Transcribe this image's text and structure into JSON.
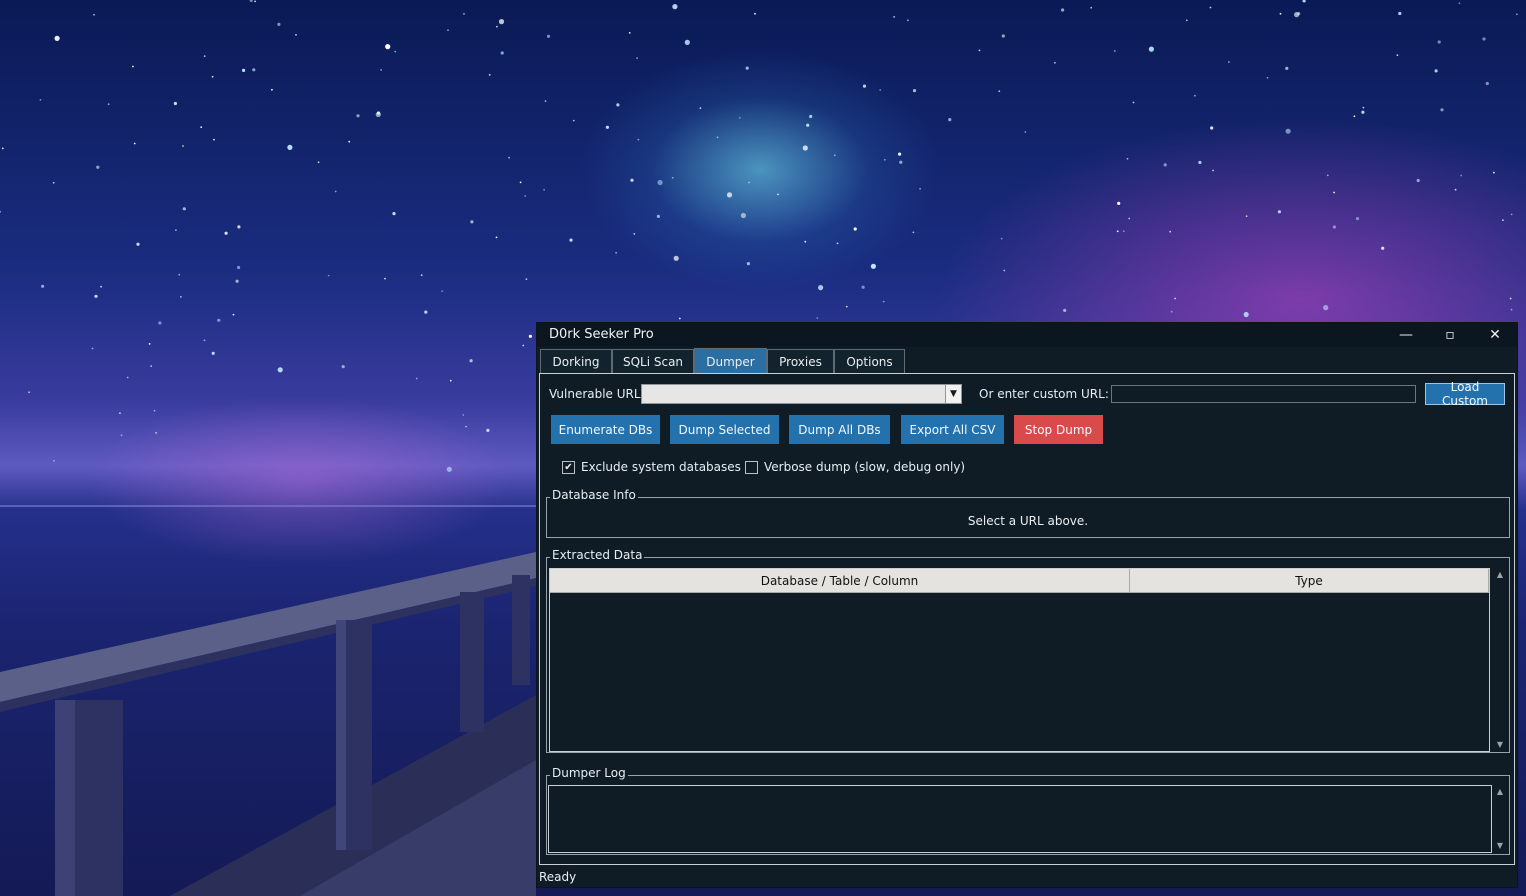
{
  "window": {
    "title": "D0rk Seeker Pro",
    "minimize_glyph": "—",
    "maximize_glyph": "▫",
    "close_glyph": "✕"
  },
  "tabs": [
    {
      "label": "Dorking",
      "active": false
    },
    {
      "label": "SQLi Scan",
      "active": false
    },
    {
      "label": "Dumper",
      "active": true
    },
    {
      "label": "Proxies",
      "active": false
    },
    {
      "label": "Options",
      "active": false
    }
  ],
  "dumper": {
    "vulnerable_url_label": "Vulnerable URL:",
    "vulnerable_url_value": "",
    "custom_url_label": "Or enter custom URL:",
    "custom_url_value": "",
    "load_custom_label": "Load Custom",
    "buttons": {
      "enumerate": "Enumerate DBs",
      "dump_selected": "Dump Selected",
      "dump_all": "Dump All DBs",
      "export_csv": "Export All CSV",
      "stop_dump": "Stop Dump"
    },
    "checkboxes": {
      "exclude_system": {
        "label": "Exclude system databases",
        "checked": true
      },
      "verbose": {
        "label": "Verbose dump (slow, debug only)",
        "checked": false
      }
    },
    "database_info": {
      "title": "Database Info",
      "message": "Select a URL above."
    },
    "extracted": {
      "title": "Extracted Data",
      "columns": [
        "Database / Table / Column",
        "Type"
      ],
      "rows": []
    },
    "log": {
      "title": "Dumper Log",
      "content": ""
    }
  },
  "status": "Ready",
  "colors": {
    "accent": "#2372ad",
    "danger": "#d94b4b",
    "window_bg": "#0f1c26"
  },
  "icons": {
    "check": "check-icon",
    "dropdown": "chevron-down-icon",
    "scroll_up": "scroll-up-icon",
    "scroll_down": "scroll-down-icon"
  }
}
